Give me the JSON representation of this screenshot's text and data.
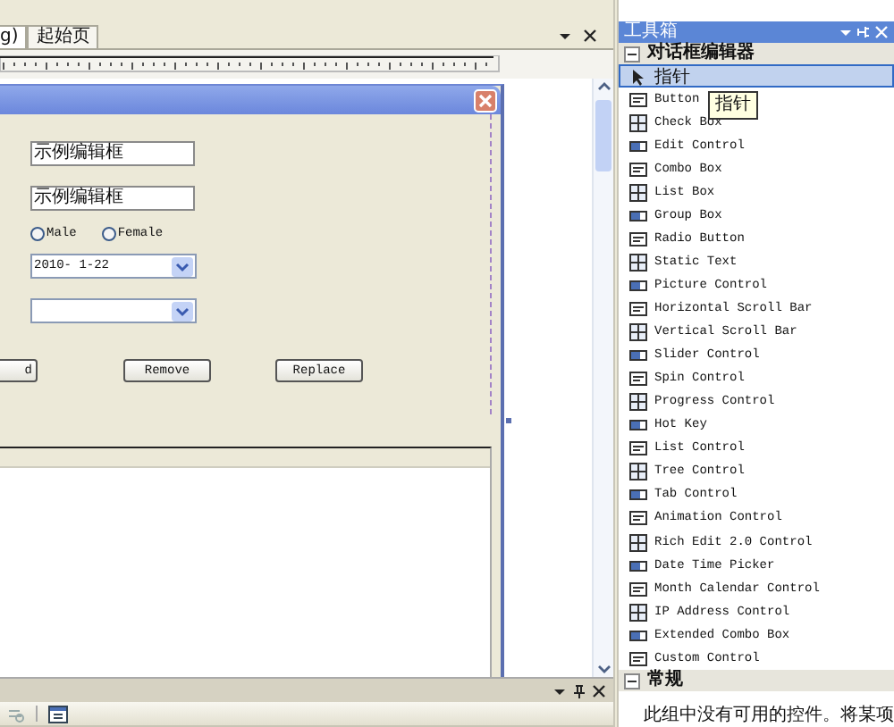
{
  "document_tabs": [
    {
      "label": "g)",
      "selected": true
    },
    {
      "label": "起始页",
      "selected": false
    }
  ],
  "dialog": {
    "edit_fields": [
      "示例编辑框",
      "示例编辑框"
    ],
    "radios": [
      {
        "label": "Male",
        "selected": false
      },
      {
        "label": "Female",
        "selected": false
      }
    ],
    "date_picker": {
      "value": "2010- 1-22"
    },
    "buttons": [
      "d",
      "Remove",
      "Replace"
    ]
  },
  "toolbox": {
    "title": "工具箱",
    "tooltip": "指针",
    "sections": [
      {
        "title": "对话框编辑器",
        "expanded": true,
        "items": [
          {
            "label": "指针",
            "selected": true
          },
          {
            "label": "Button",
            "selected": false
          },
          {
            "label": "Check Box",
            "selected": false
          },
          {
            "label": "Edit Control",
            "selected": false
          },
          {
            "label": "Combo Box",
            "selected": false
          },
          {
            "label": "List Box",
            "selected": false
          },
          {
            "label": "Group Box",
            "selected": false
          },
          {
            "label": "Radio Button",
            "selected": false
          },
          {
            "label": "Static Text",
            "selected": false
          },
          {
            "label": "Picture Control",
            "selected": false
          },
          {
            "label": "Horizontal Scroll Bar",
            "selected": false
          },
          {
            "label": "Vertical Scroll Bar",
            "selected": false
          },
          {
            "label": "Slider Control",
            "selected": false
          },
          {
            "label": "Spin Control",
            "selected": false
          },
          {
            "label": "Progress Control",
            "selected": false
          },
          {
            "label": "Hot Key",
            "selected": false
          },
          {
            "label": "List Control",
            "selected": false
          },
          {
            "label": "Tree Control",
            "selected": false
          },
          {
            "label": "Tab Control",
            "selected": false
          },
          {
            "label": "Animation Control",
            "selected": false
          },
          {
            "label": "Rich Edit 2.0 Control",
            "selected": false
          },
          {
            "label": "Date Time Picker",
            "selected": false
          },
          {
            "label": "Month Calendar Control",
            "selected": false
          },
          {
            "label": "IP Address Control",
            "selected": false
          },
          {
            "label": "Extended Combo Box",
            "selected": false
          },
          {
            "label": "Custom Control",
            "selected": false
          }
        ]
      },
      {
        "title": "常规",
        "expanded": true,
        "message": "此组中没有可用的控件。将某项"
      }
    ]
  }
}
